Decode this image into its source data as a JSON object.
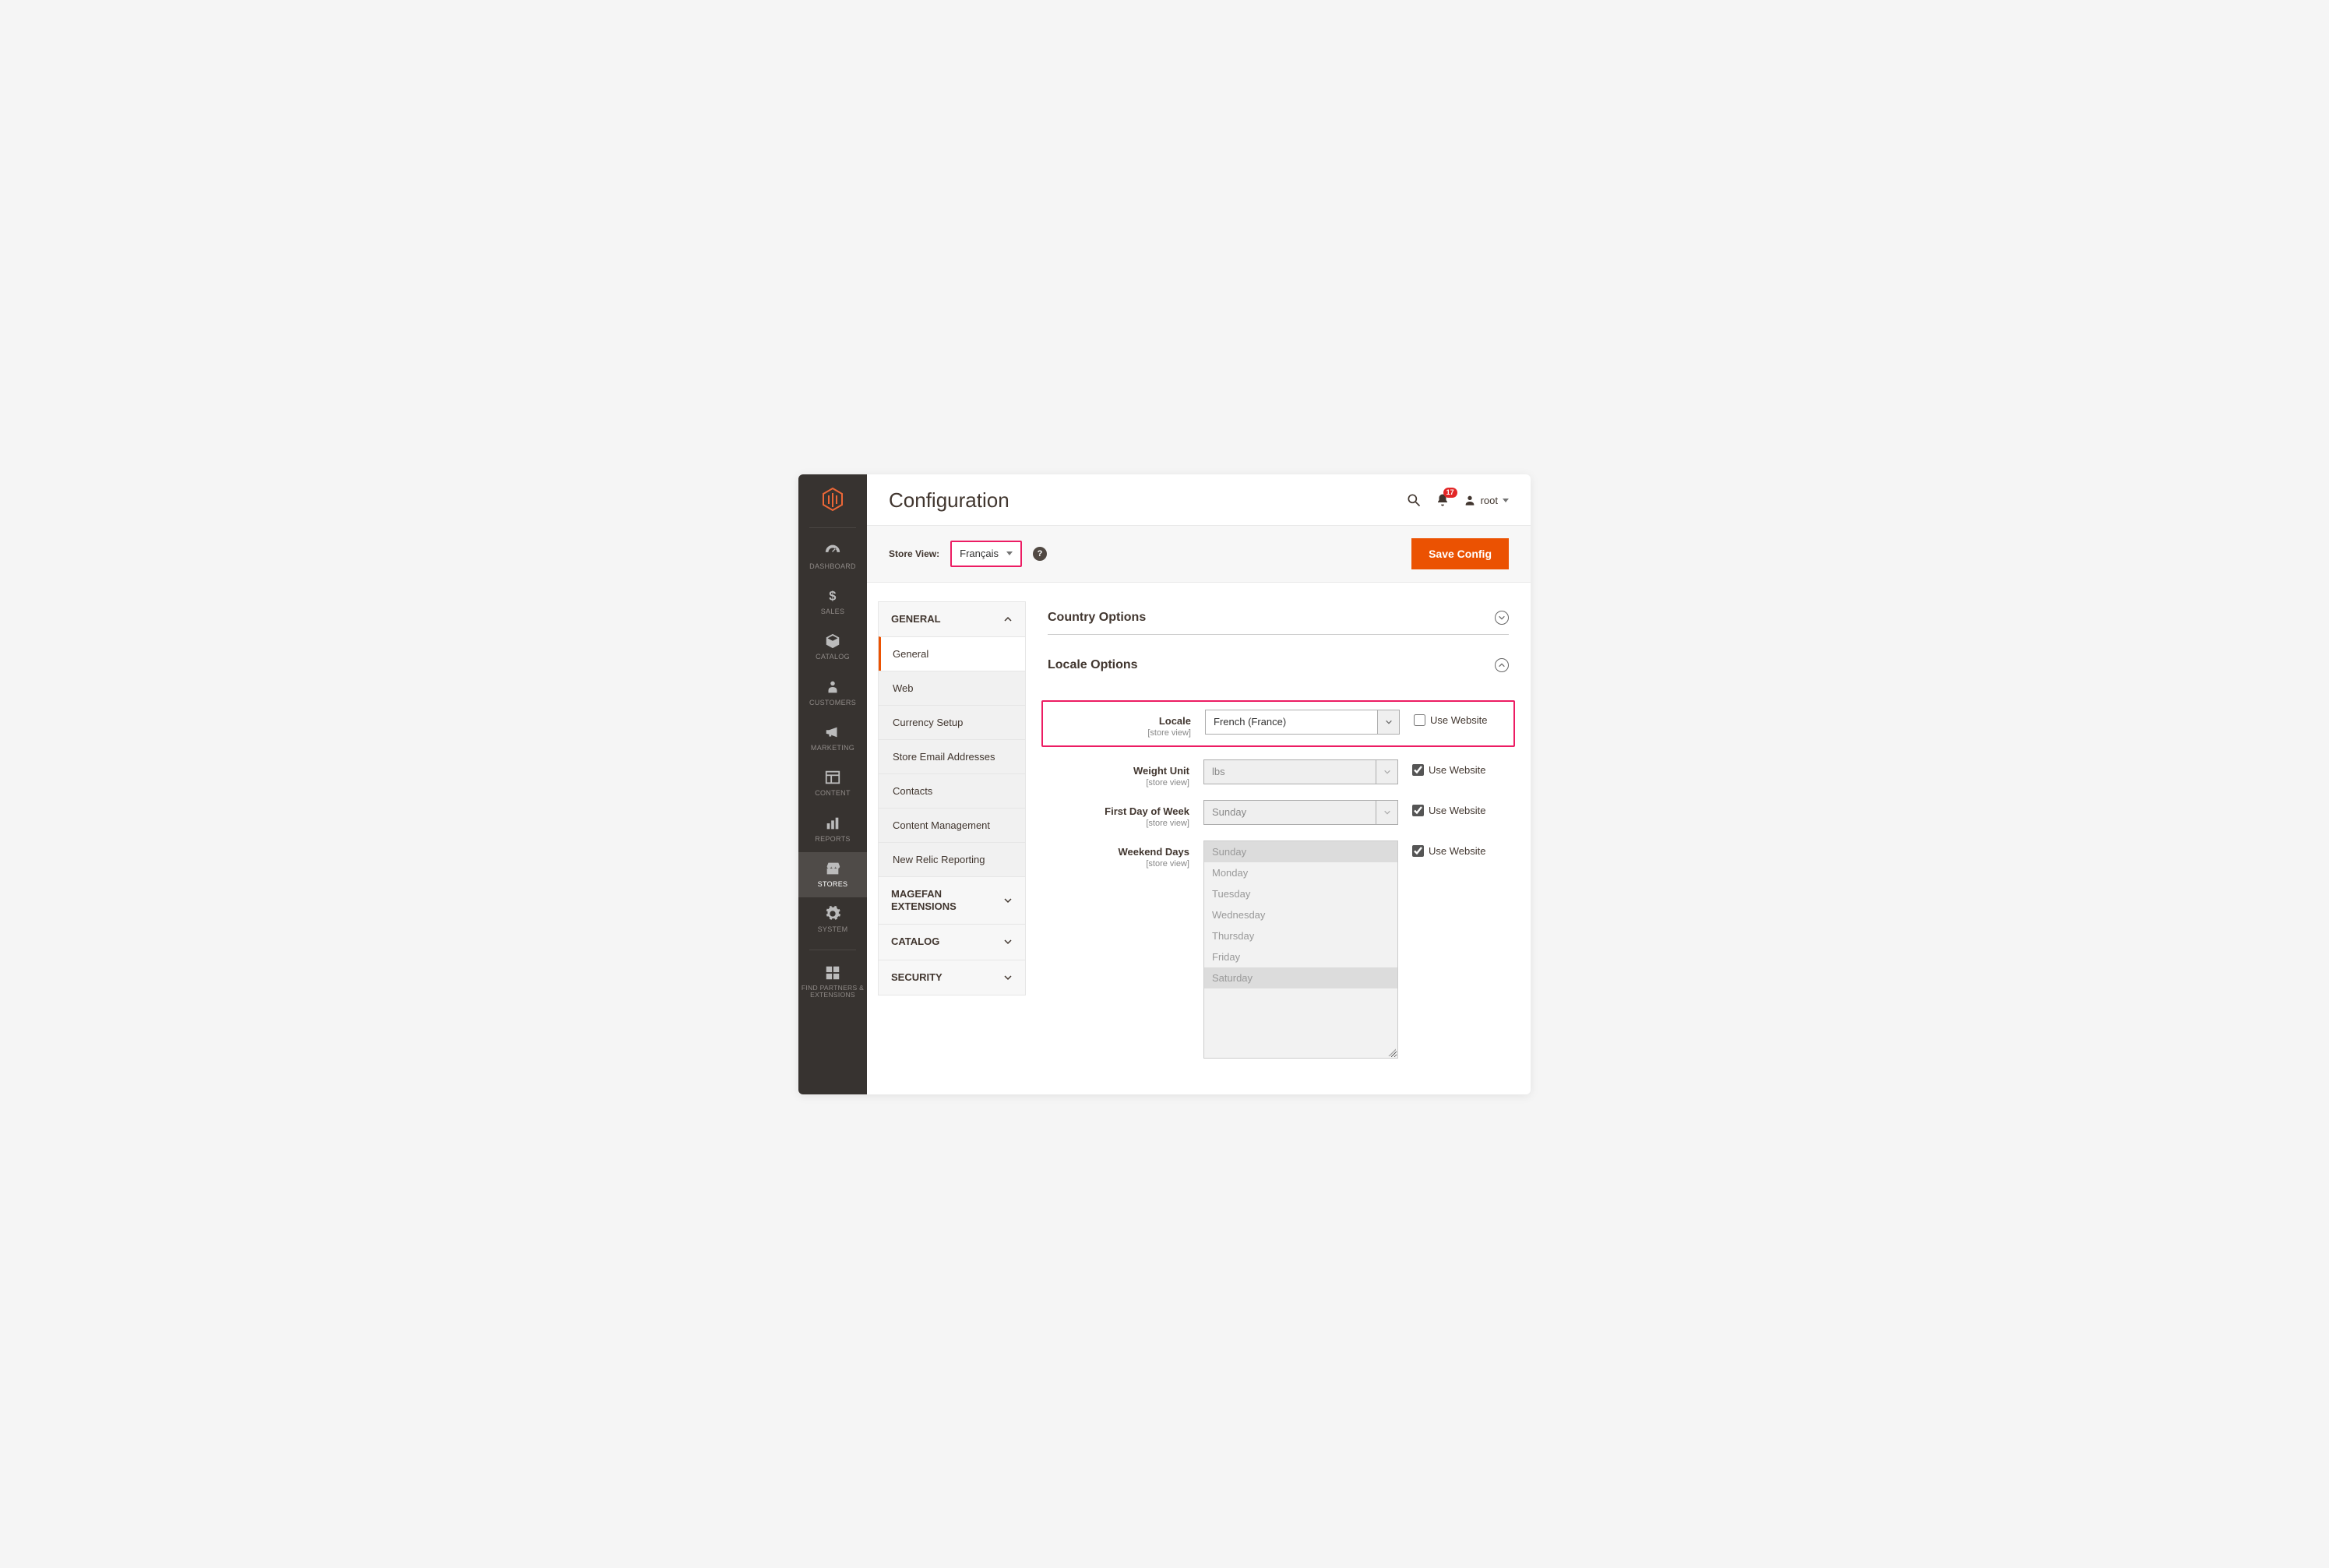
{
  "sidebar": {
    "items": [
      {
        "label": "DASHBOARD",
        "icon": "gauge"
      },
      {
        "label": "SALES",
        "icon": "dollar"
      },
      {
        "label": "CATALOG",
        "icon": "box"
      },
      {
        "label": "CUSTOMERS",
        "icon": "person"
      },
      {
        "label": "MARKETING",
        "icon": "megaphone"
      },
      {
        "label": "CONTENT",
        "icon": "layout"
      },
      {
        "label": "REPORTS",
        "icon": "bars"
      },
      {
        "label": "STORES",
        "icon": "storefront"
      },
      {
        "label": "SYSTEM",
        "icon": "gear"
      },
      {
        "label": "FIND PARTNERS & EXTENSIONS",
        "icon": "blocks"
      }
    ],
    "active_index": 7
  },
  "header": {
    "title": "Configuration",
    "notification_count": "17",
    "username": "root"
  },
  "scope": {
    "label": "Store View:",
    "value": "Français",
    "save_button": "Save Config"
  },
  "config_sidebar": {
    "groups": [
      {
        "label": "GENERAL",
        "expanded": true,
        "items": [
          "General",
          "Web",
          "Currency Setup",
          "Store Email Addresses",
          "Contacts",
          "Content Management",
          "New Relic Reporting"
        ],
        "active_item": 0
      },
      {
        "label": "MAGEFAN EXTENSIONS",
        "expanded": false
      },
      {
        "label": "CATALOG",
        "expanded": false
      },
      {
        "label": "SECURITY",
        "expanded": false
      }
    ]
  },
  "sections": {
    "country": {
      "title": "Country Options",
      "expanded": false
    },
    "locale": {
      "title": "Locale Options",
      "expanded": true,
      "scope_note": "[store view]",
      "use_website_label": "Use Website",
      "fields": {
        "locale": {
          "label": "Locale",
          "value": "French (France)",
          "use_website": false,
          "disabled": false
        },
        "weight_unit": {
          "label": "Weight Unit",
          "value": "lbs",
          "use_website": true,
          "disabled": true
        },
        "first_day": {
          "label": "First Day of Week",
          "value": "Sunday",
          "use_website": true,
          "disabled": true
        },
        "weekend_days": {
          "label": "Weekend Days",
          "use_website": true,
          "disabled": true,
          "options": [
            "Sunday",
            "Monday",
            "Tuesday",
            "Wednesday",
            "Thursday",
            "Friday",
            "Saturday"
          ],
          "selected": [
            "Sunday",
            "Saturday"
          ]
        }
      }
    }
  }
}
